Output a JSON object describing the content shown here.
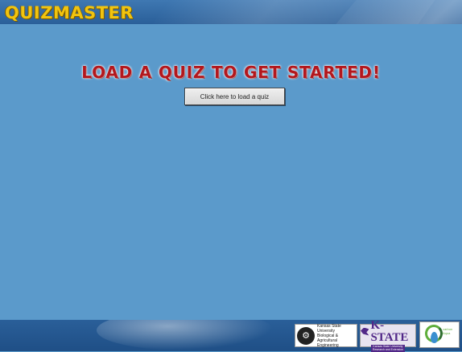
{
  "app": {
    "title": "QuizMaster"
  },
  "main": {
    "headline": "Load a quiz to get started!",
    "load_button_label": "Click here to load a quiz"
  },
  "footer": {
    "logos": {
      "ksu_bae_lines": [
        "Kansas State University",
        "Biological & Agricultural",
        "Engineering"
      ],
      "kstate_word": "K-STATE",
      "kstate_sub": [
        "Kansas State University",
        "Research and Extension"
      ],
      "water_text": "carbon Aqua"
    }
  },
  "colors": {
    "background": "#5b9acb",
    "header_bar": "#2a5f99",
    "title_gold": "#f1c40f",
    "headline_red": "#b3171d",
    "kstate_purple": "#512888"
  }
}
